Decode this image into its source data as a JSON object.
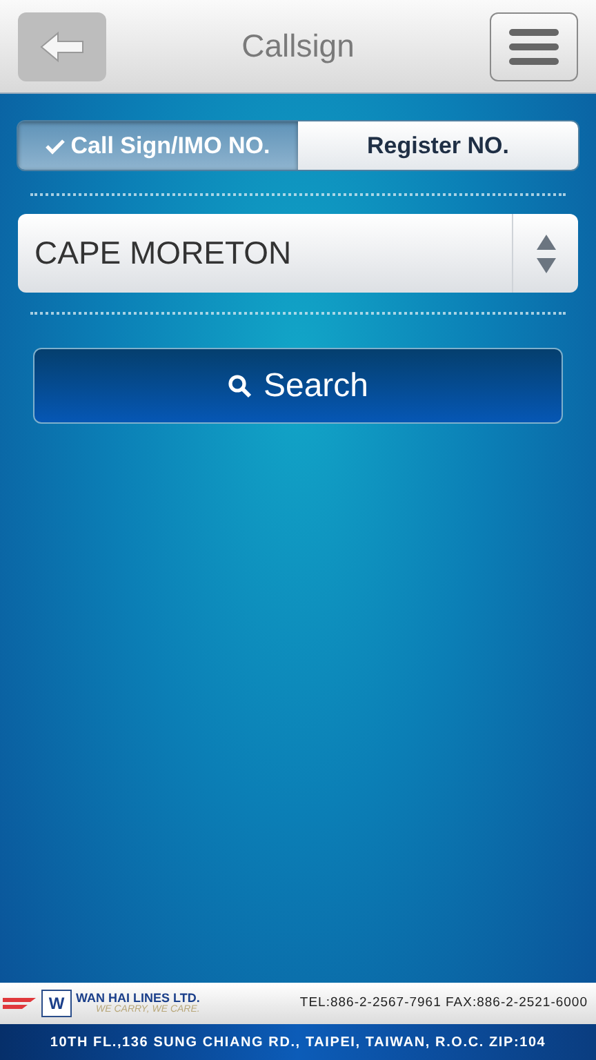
{
  "header": {
    "title": "Callsign"
  },
  "tabs": [
    {
      "label": "Call Sign/IMO NO.",
      "selected": true
    },
    {
      "label": "Register NO.",
      "selected": false
    }
  ],
  "vessel_select": {
    "value": "CAPE MORETON"
  },
  "search_button": {
    "label": "Search"
  },
  "footer": {
    "logo_mark": "W",
    "company": "WAN HAI LINES LTD.",
    "slogan": "WE CARRY, WE CARE.",
    "contact": "TEL:886-2-2567-7961 FAX:886-2-2521-6000",
    "address": "10TH FL.,136 SUNG CHIANG RD., TAIPEI, TAIWAN, R.O.C. ZIP:104"
  }
}
